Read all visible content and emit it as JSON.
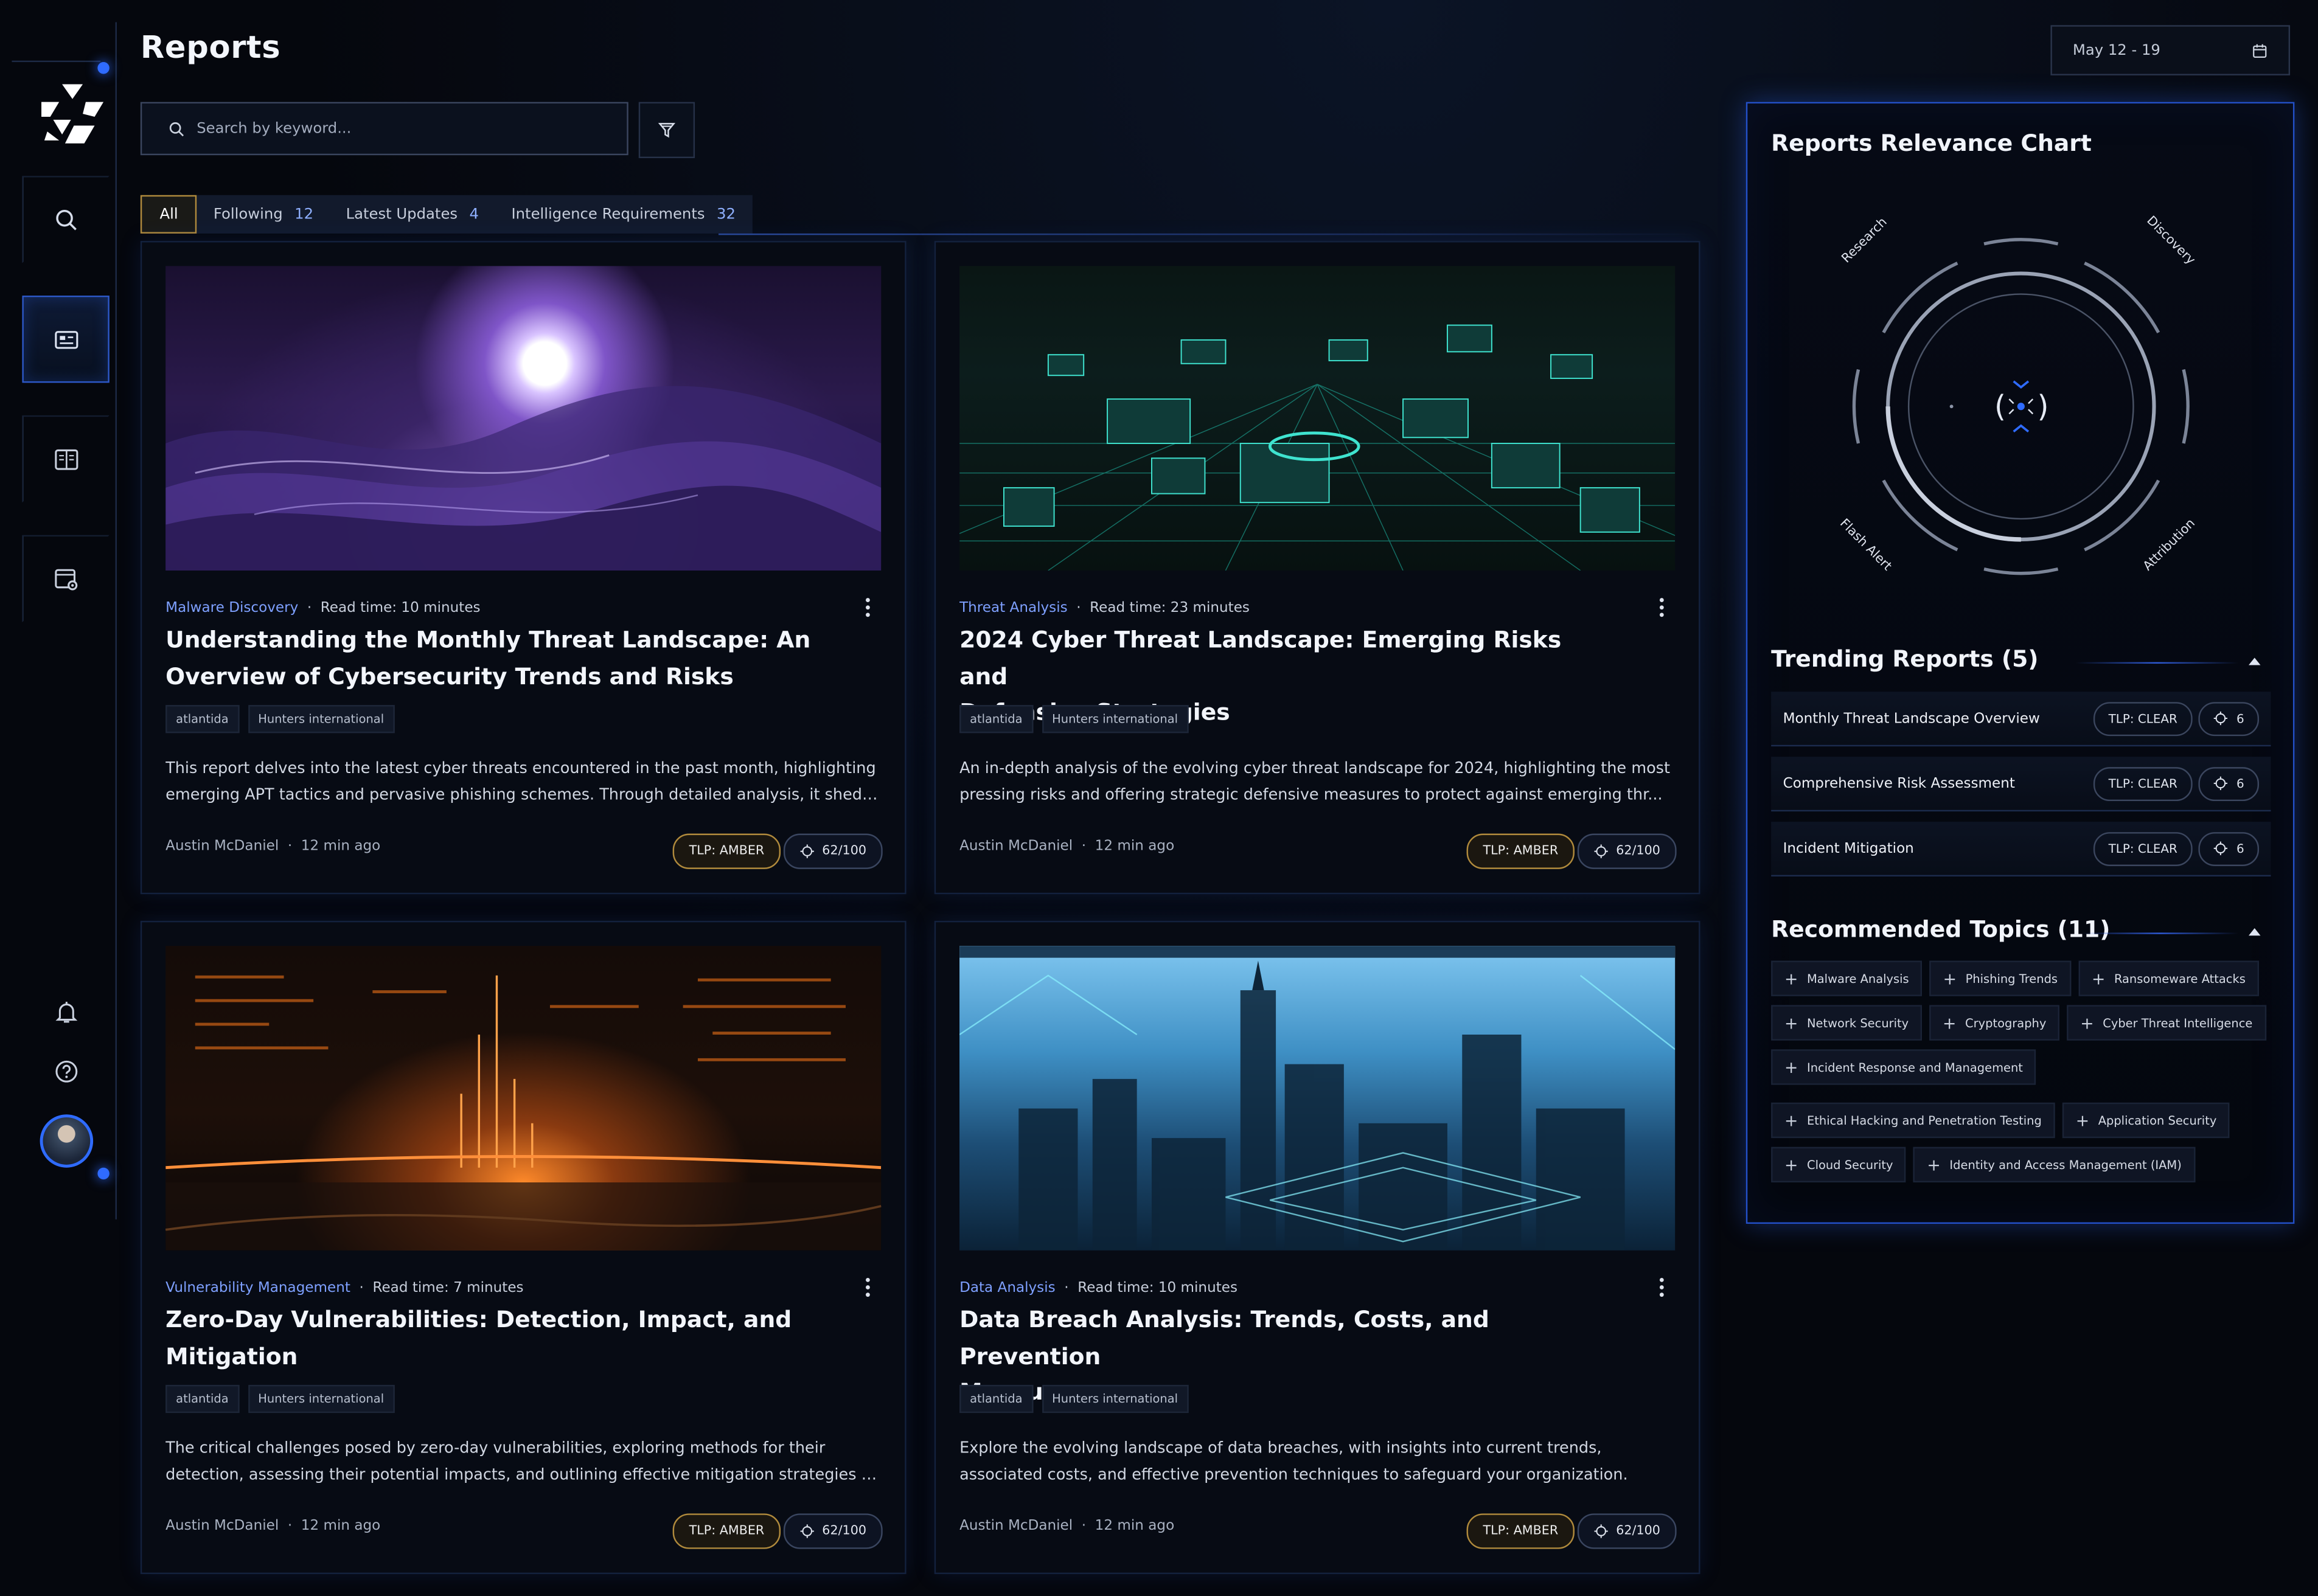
{
  "page": {
    "title": "Reports"
  },
  "search": {
    "placeholder": "Search by keyword..."
  },
  "date_range": {
    "label": "May 12 - 19"
  },
  "tabs": [
    {
      "label": "All",
      "count": ""
    },
    {
      "label": "Following",
      "count": "12"
    },
    {
      "label": "Latest Updates",
      "count": "4"
    },
    {
      "label": "Intelligence Requirements",
      "count": "32"
    }
  ],
  "sidebar": {
    "items": [
      {
        "icon": "search-icon"
      },
      {
        "icon": "reports-icon"
      },
      {
        "icon": "book-icon"
      },
      {
        "icon": "browser-settings-icon"
      }
    ],
    "bottom": [
      {
        "icon": "bell-icon"
      },
      {
        "icon": "help-icon"
      },
      {
        "icon": "avatar"
      }
    ]
  },
  "cards": [
    {
      "category": "Malware Discovery",
      "read_time": "Read time: 10 minutes",
      "title_line1": "Understanding the Monthly Threat Landscape: An",
      "title_line2": "Overview of Cybersecurity Trends and Risks",
      "tags": [
        "atlantida",
        "Hunters international"
      ],
      "desc_line1": "This report delves into the latest cyber threats encountered in the past month, highlighting",
      "desc_line2": "emerging APT tactics and pervasive phishing schemes. Through detailed analysis, it sheds...",
      "author": "Austin McDaniel",
      "time": "12 min ago",
      "tlp": "TLP: AMBER",
      "score": "62/100"
    },
    {
      "category": "Threat Analysis",
      "read_time": "Read time: 23 minutes",
      "title_line1": "2024 Cyber Threat Landscape: Emerging Risks and",
      "title_line2": "Defensive Strategies",
      "tags": [
        "atlantida",
        "Hunters international"
      ],
      "desc_line1": "An in-depth analysis of the evolving cyber threat landscape for 2024, highlighting the most",
      "desc_line2": "pressing risks and offering strategic defensive measures to protect against emerging thr...",
      "author": "Austin McDaniel",
      "time": "12 min ago",
      "tlp": "TLP: AMBER",
      "score": "62/100"
    },
    {
      "category": "Vulnerability Management",
      "read_time": "Read time: 7 minutes",
      "title_line1": "Zero-Day Vulnerabilities: Detection, Impact, and",
      "title_line2": "Mitigation",
      "tags": [
        "atlantida",
        "Hunters international"
      ],
      "desc_line1": "The critical challenges posed by zero-day vulnerabilities, exploring methods for their",
      "desc_line2": "detection, assessing their potential impacts, and outlining effective mitigation strategies t...",
      "author": "Austin McDaniel",
      "time": "12 min ago",
      "tlp": "TLP: AMBER",
      "score": "62/100"
    },
    {
      "category": "Data Analysis",
      "read_time": "Read time: 10 minutes",
      "title_line1": "Data Breach Analysis: Trends, Costs, and Prevention",
      "title_line2": "Measures",
      "tags": [
        "atlantida",
        "Hunters international"
      ],
      "desc_line1": "Explore the evolving landscape of data breaches, with insights into current trends,",
      "desc_line2": "associated costs, and effective prevention techniques to safeguard your organization.",
      "author": "Austin McDaniel",
      "time": "12 min ago",
      "tlp": "TLP: AMBER",
      "score": "62/100"
    }
  ],
  "relevance": {
    "title": "Reports Relevance Chart",
    "labels": [
      "Research",
      "Discovery",
      "Flash Alert",
      "Attribution"
    ]
  },
  "trending": {
    "title": "Trending Reports (5)",
    "rows": [
      {
        "label": "Monthly Threat Landscape Overview",
        "tlp": "TLP: CLEAR",
        "count": "6"
      },
      {
        "label": "Comprehensive Risk Assessment",
        "tlp": "TLP: CLEAR",
        "count": "6"
      },
      {
        "label": "Incident Mitigation",
        "tlp": "TLP: CLEAR",
        "count": "6"
      }
    ]
  },
  "topics": {
    "title": "Recommended Topics (11)",
    "items": [
      "Malware Analysis",
      "Phishing Trends",
      "Ransomeware Attacks",
      "Network Security",
      "Cryptography",
      "Cyber Threat Intelligence",
      "Incident Response and Management",
      "Ethical Hacking and Penetration Testing",
      "Application Security",
      "Cloud Security",
      "Identity and Access Management (IAM)"
    ]
  },
  "colors": {
    "accent": "#2f6bff",
    "amber": "#b08a3c",
    "category": "#7ea0ff",
    "background": "#05070d"
  }
}
